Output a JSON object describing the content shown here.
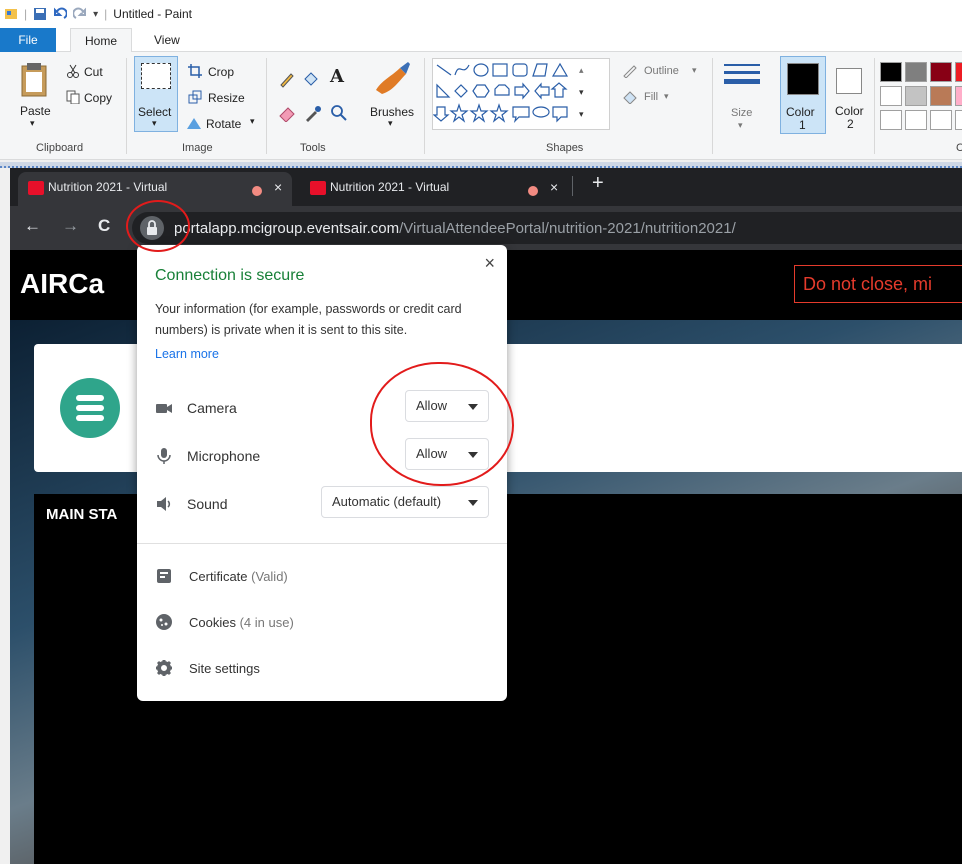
{
  "paint": {
    "title": "Untitled - Paint",
    "tabs": [
      "File",
      "Home",
      "View"
    ],
    "clipboard": {
      "paste": "Paste",
      "cut": "Cut",
      "copy": "Copy",
      "label": "Clipboard"
    },
    "image": {
      "select": "Select",
      "crop": "Crop",
      "resize": "Resize",
      "rotate": "Rotate",
      "label": "Image"
    },
    "tools": {
      "label": "Tools",
      "brushes": "Brushes",
      "text": "A"
    },
    "shapes": {
      "outline": "Outline",
      "fill": "Fill",
      "label": "Shapes"
    },
    "size": "Size",
    "color1": "Color",
    "color1_num": "1",
    "color2": "Color",
    "color2_num": "2",
    "colors_label": "C",
    "palette": [
      "#000000",
      "#7f7f7f",
      "#880015",
      "#ed1c24",
      "#ffffff",
      "#c3c3c3",
      "#b97a57",
      "#ffaec9",
      "#ffffff",
      "#ffffff",
      "#ffffff",
      "#ffffff"
    ]
  },
  "browser": {
    "tabs": [
      {
        "title": "Nutrition 2021 - Virtual",
        "close": "×"
      },
      {
        "title": "Nutrition 2021 - Virtual",
        "close": "×"
      }
    ],
    "new_tab": "+",
    "back": "←",
    "forward": "→",
    "reload": "C",
    "url_domain": "portalapp.mcigroup.eventsair.com",
    "url_path": "/VirtualAttendeePortal/nutrition-2021/nutrition2021/"
  },
  "page": {
    "site_title": "AIRCa",
    "warning": "Do not close, mi",
    "stage_title": "MAIN STA"
  },
  "popup": {
    "close": "×",
    "title": "Connection is secure",
    "description": "Your information (for example, passwords or credit card numbers) is private when it is sent to this site.",
    "learn_more": "Learn more",
    "permissions": [
      {
        "label": "Camera",
        "value": "Allow",
        "icon": "camera-icon"
      },
      {
        "label": "Microphone",
        "value": "Allow",
        "icon": "microphone-icon"
      },
      {
        "label": "Sound",
        "value": "Automatic (default)",
        "icon": "speaker-icon"
      }
    ],
    "certificate": "Certificate",
    "certificate_status": "(Valid)",
    "cookies": "Cookies",
    "cookies_status": "(4 in use)",
    "site_settings": "Site settings"
  },
  "colors": {
    "paint_file_tab": "#1979ca",
    "secure_green": "#188038",
    "link_blue": "#1a73e8",
    "annotation_red": "#e21b1b",
    "warning_red": "#e53b2c",
    "menu_teal": "#2fa58b"
  }
}
